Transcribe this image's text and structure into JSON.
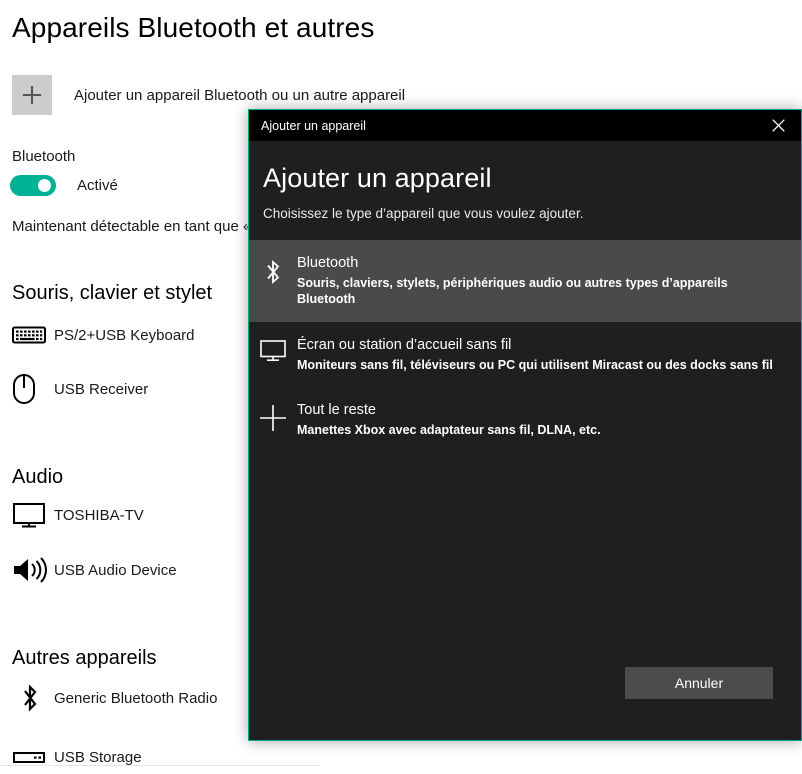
{
  "settings": {
    "page_title": "Appareils Bluetooth et autres",
    "add_device": {
      "icon": "plus-icon",
      "label": "Ajouter un appareil Bluetooth ou un autre appareil"
    },
    "bluetooth": {
      "heading": "Bluetooth",
      "toggle_state_label": "Activé",
      "toggle_on": true,
      "toggle_color": "#00b294",
      "discoverable_text": "Maintenant détectable en tant que «"
    },
    "groups": [
      {
        "heading": "Souris, clavier et stylet",
        "devices": [
          {
            "icon": "keyboard-icon",
            "label": "PS/2+USB Keyboard"
          },
          {
            "icon": "mouse-icon",
            "label": "USB Receiver"
          }
        ]
      },
      {
        "heading": "Audio",
        "devices": [
          {
            "icon": "monitor-icon",
            "label": "TOSHIBA-TV"
          },
          {
            "icon": "speaker-icon",
            "label": "USB Audio Device"
          }
        ]
      },
      {
        "heading": "Autres appareils",
        "devices": [
          {
            "icon": "bluetooth-icon",
            "label": "Generic Bluetooth Radio"
          },
          {
            "icon": "usb-storage-icon",
            "label": "USB Storage"
          }
        ]
      }
    ]
  },
  "dialog": {
    "titlebar": {
      "title": "Ajouter un appareil",
      "close_icon": "close-icon"
    },
    "heading": "Ajouter un appareil",
    "subheading": "Choisissez le type d’appareil que vous voulez ajouter.",
    "accent_color": "#00a98f",
    "options": [
      {
        "icon": "bluetooth-icon",
        "title": "Bluetooth",
        "description": "Souris, claviers, stylets, périphériques audio ou autres types d’appareils Bluetooth",
        "selected": true
      },
      {
        "icon": "monitor-icon",
        "title": "Écran ou station d’accueil sans fil",
        "description": "Moniteurs sans fil, téléviseurs ou PC qui utilisent Miracast ou des docks sans fil",
        "selected": false
      },
      {
        "icon": "plus-icon",
        "title": "Tout le reste",
        "description": "Manettes Xbox avec adaptateur sans fil, DLNA, etc.",
        "selected": false
      }
    ],
    "cancel_label": "Annuler"
  }
}
